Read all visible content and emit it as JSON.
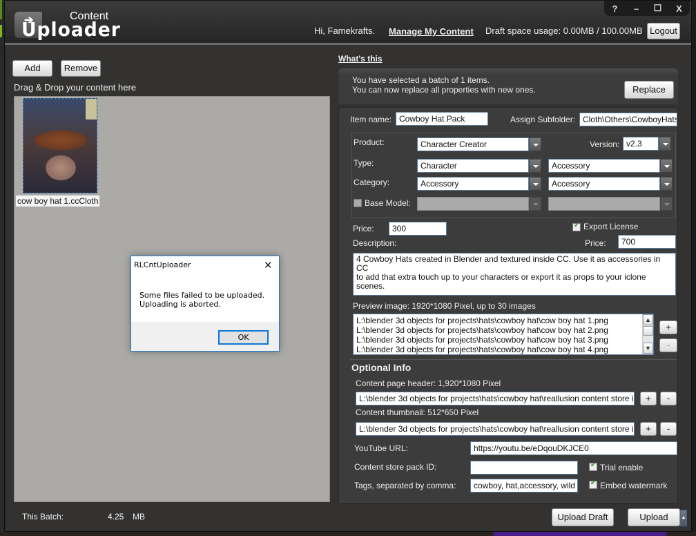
{
  "app": {
    "logo_top": "Content",
    "logo_main": "Uploader"
  },
  "window_controls": {
    "help": "?",
    "minimize": "–",
    "maximize": "☐",
    "close": "X"
  },
  "header": {
    "greeting": "Hi, Famekrafts.",
    "manage_link": "Manage My Content",
    "draft_usage": "Draft space usage: 0.00MB / 100.00MB",
    "logout": "Logout"
  },
  "left": {
    "add": "Add",
    "remove": "Remove",
    "drop_label": "Drag & Drop your content here",
    "items": [
      {
        "label": "cow boy hat 1.ccCloth"
      }
    ],
    "batch_label": "This Batch:",
    "batch_value": "4.25",
    "batch_unit": "MB"
  },
  "right": {
    "whats_this": "What's this",
    "info_line1": "You have selected a batch of 1 items.",
    "info_line2": "You can now replace all properties with new ones.",
    "replace": "Replace",
    "item_name_label": "Item name:",
    "item_name": "Cowboy Hat Pack",
    "subfolder_label": "Assign Subfolder:",
    "subfolder": "Cloth\\Others\\CowboyHats",
    "product_label": "Product:",
    "product": "Character Creator",
    "version_label": "Version:",
    "version": "v2.3",
    "type_label": "Type:",
    "type1": "Character",
    "type2": "Accessory",
    "category_label": "Category:",
    "category1": "Accessory",
    "category2": "Accessory",
    "base_model_label": "Base Model:",
    "base_model_checked": false,
    "price_label": "Price:",
    "price": "300",
    "export_license_label": "Export License",
    "export_license_checked": true,
    "export_price_label": "Price:",
    "export_price": "700",
    "description_label": "Description:",
    "description": "4 Cowboy Hats created in Blender and textured inside CC. Use it as accessories in CC\nto add that extra touch up to your characters or export it as props to your iclone\nscenes.",
    "preview_label": "Preview image: 1920*1080 Pixel, up to 30 images",
    "preview_images": [
      "L:\\blender 3d objects for projects\\hats\\cowboy hat\\cow boy hat 1.png",
      "L:\\blender 3d objects for projects\\hats\\cowboy hat\\cow boy hat 2.png",
      "L:\\blender 3d objects for projects\\hats\\cowboy hat\\cow boy hat 3.png",
      "L:\\blender 3d objects for projects\\hats\\cowboy hat\\cow boy hat 4.png"
    ],
    "add_btn": "+",
    "remove_btn": "-",
    "optional_title": "Optional Info",
    "header_img_label": "Content page header: 1,920*1080 Pixel",
    "header_img": "L:\\blender 3d objects for projects\\hats\\cowboy hat\\reallusion content store i",
    "thumb_label": "Content thumbnail: 512*650 Pixel",
    "thumb_img": "L:\\blender 3d objects for projects\\hats\\cowboy hat\\reallusion content store i",
    "youtube_label": "YouTube URL:",
    "youtube": "https://youtu.be/eDqouDKJCE0",
    "pack_id_label": "Content store pack ID:",
    "pack_id": "",
    "trial_label": "Trial enable",
    "trial_checked": true,
    "tags_label": "Tags, separated by comma:",
    "tags": "cowboy, hat,accessory, wild",
    "watermark_label": "Embed watermark",
    "watermark_checked": true
  },
  "footer": {
    "upload_draft": "Upload Draft",
    "upload": "Upload",
    "upload_menu": "▲"
  },
  "dialog": {
    "title": "RLCntUploader",
    "close": "✕",
    "line1": "Some files failed to be uploaded.",
    "line2": "Uploading is aborted.",
    "ok": "OK"
  }
}
